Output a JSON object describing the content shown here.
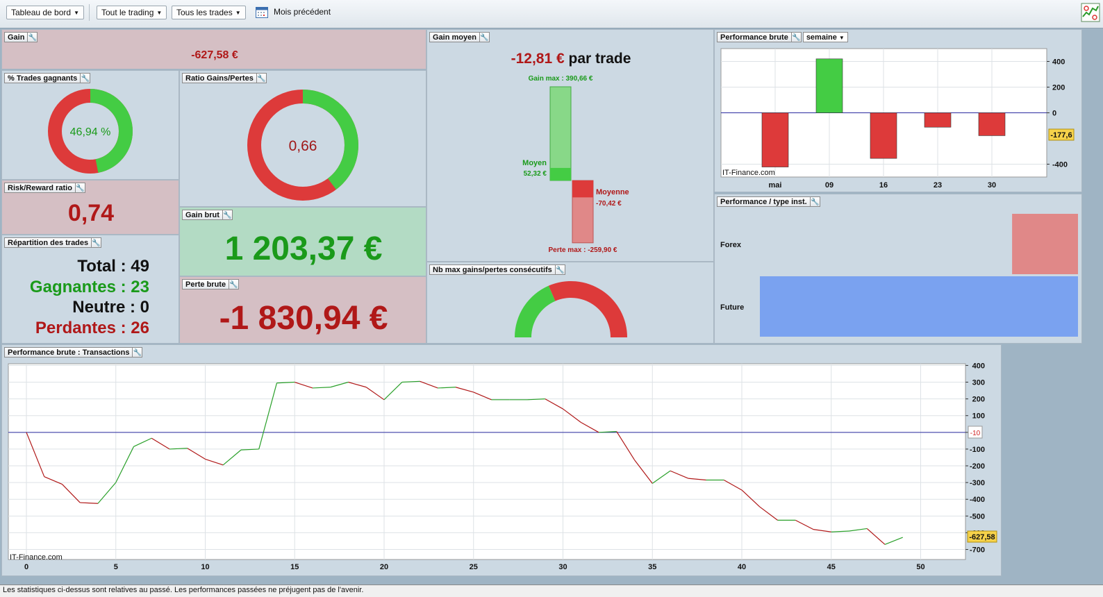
{
  "toolbar": {
    "dashboard_label": "Tableau de bord",
    "trading_label": "Tout le trading",
    "trades_label": "Tous les trades",
    "period_label": "Mois précédent"
  },
  "gain": {
    "title": "Gain",
    "value": "-627,58 €"
  },
  "win_pct": {
    "title": "% Trades gagnants",
    "value": "46,94 %",
    "fraction": 0.4694
  },
  "ratio": {
    "title": "Ratio Gains/Pertes",
    "value": "0,66",
    "fraction": 0.3976
  },
  "risk_reward": {
    "title": "Risk/Reward ratio",
    "value": "0,74"
  },
  "repartition": {
    "title": "Répartition des trades",
    "total_label": "Total :",
    "total": "49",
    "win_label": "Gagnantes :",
    "win": "23",
    "neutral_label": "Neutre :",
    "neutral": "0",
    "loss_label": "Perdantes :",
    "loss": "26"
  },
  "gross_gain": {
    "title": "Gain brut",
    "value": "1 203,37 €"
  },
  "gross_loss": {
    "title": "Perte brute",
    "value": "-1 830,94 €"
  },
  "avg_gain": {
    "title": "Gain moyen",
    "value": "-12,81 €",
    "suffix": "par trade",
    "max_gain_label": "Gain max : 390,66 €",
    "avg_win_label": "Moyen",
    "avg_win_value": "52,32 €",
    "avg_loss_label": "Moyenne",
    "avg_loss_value": "-70,42 €",
    "max_loss_label": "Perte max : -259,90 €",
    "max_gain": 390.66,
    "avg_win": 52.32,
    "avg_loss": -70.42,
    "max_loss": -259.9
  },
  "consecutive": {
    "title": "Nb max gains/pertes consécutifs",
    "win_fraction": 0.37
  },
  "weekly": {
    "title": "Performance brute",
    "period": "semaine",
    "watermark": "IT-Finance.com",
    "last_value": "-177,6"
  },
  "instrument": {
    "title": "Performance / type inst.",
    "forex_label": "Forex",
    "future_label": "Future"
  },
  "transactions": {
    "title": "Performance brute : Transactions",
    "watermark": "IT-Finance.com",
    "marker_value": "-10",
    "last_value": "-627,58"
  },
  "footer": {
    "text": "Les statistiques ci-dessus sont relatives au passé. Les performances passées ne préjugent pas de l'avenir."
  },
  "colors": {
    "green": "#44cc44",
    "red": "#dd3a3a",
    "blue": "#7aa2f0",
    "pink": "#e08888"
  },
  "chart_data": [
    {
      "type": "bar",
      "categories": [
        "mai",
        "09",
        "16",
        "23",
        "30"
      ],
      "values": [
        -422,
        420,
        -355,
        -112,
        -178
      ],
      "ylim": [
        -500,
        500
      ],
      "yticks": [
        400,
        200,
        0,
        -400
      ],
      "ytick_labels": [
        "400",
        "200",
        "0",
        "-400"
      ],
      "grid": true
    },
    {
      "type": "bar",
      "orientation": "horizontal",
      "categories": [
        "Forex",
        "Future"
      ],
      "values": [
        -627.58,
        1030
      ]
    },
    {
      "type": "line",
      "x": [
        0,
        1,
        2,
        3,
        4,
        5,
        6,
        7,
        8,
        9,
        10,
        11,
        12,
        13,
        14,
        15,
        16,
        17,
        18,
        19,
        20,
        21,
        22,
        23,
        24,
        25,
        26,
        27,
        28,
        29,
        30,
        31,
        32,
        33,
        34,
        35,
        36,
        37,
        38,
        39,
        40,
        41,
        42,
        43,
        44,
        45,
        46,
        47,
        48,
        49
      ],
      "y": [
        0,
        -265,
        -310,
        -420,
        -425,
        -300,
        -85,
        -35,
        -100,
        -95,
        -160,
        -195,
        -105,
        -100,
        295,
        300,
        265,
        270,
        300,
        270,
        195,
        300,
        305,
        265,
        270,
        240,
        195,
        195,
        195,
        200,
        140,
        60,
        0,
        5,
        -165,
        -305,
        -230,
        -275,
        -285,
        -285,
        -345,
        -445,
        -525,
        -525,
        -580,
        -595,
        -590,
        -575,
        -670,
        -627.58
      ],
      "ylim": [
        -760,
        410
      ],
      "yticks": [
        400,
        300,
        200,
        100,
        0,
        -100,
        -200,
        -300,
        -400,
        -500,
        -600,
        -700
      ],
      "ytick_labels": [
        "400",
        "300",
        "200",
        "100",
        "",
        "-100",
        "-200",
        "-300",
        "-400",
        "-500",
        "-600",
        "-700"
      ],
      "xticks": [
        0,
        5,
        10,
        15,
        20,
        25,
        30,
        35,
        40,
        45,
        50
      ],
      "xtick_labels": [
        "0",
        "5",
        "10",
        "15",
        "20",
        "25",
        "30",
        "35",
        "40",
        "45",
        "50"
      ],
      "grid": true
    }
  ]
}
